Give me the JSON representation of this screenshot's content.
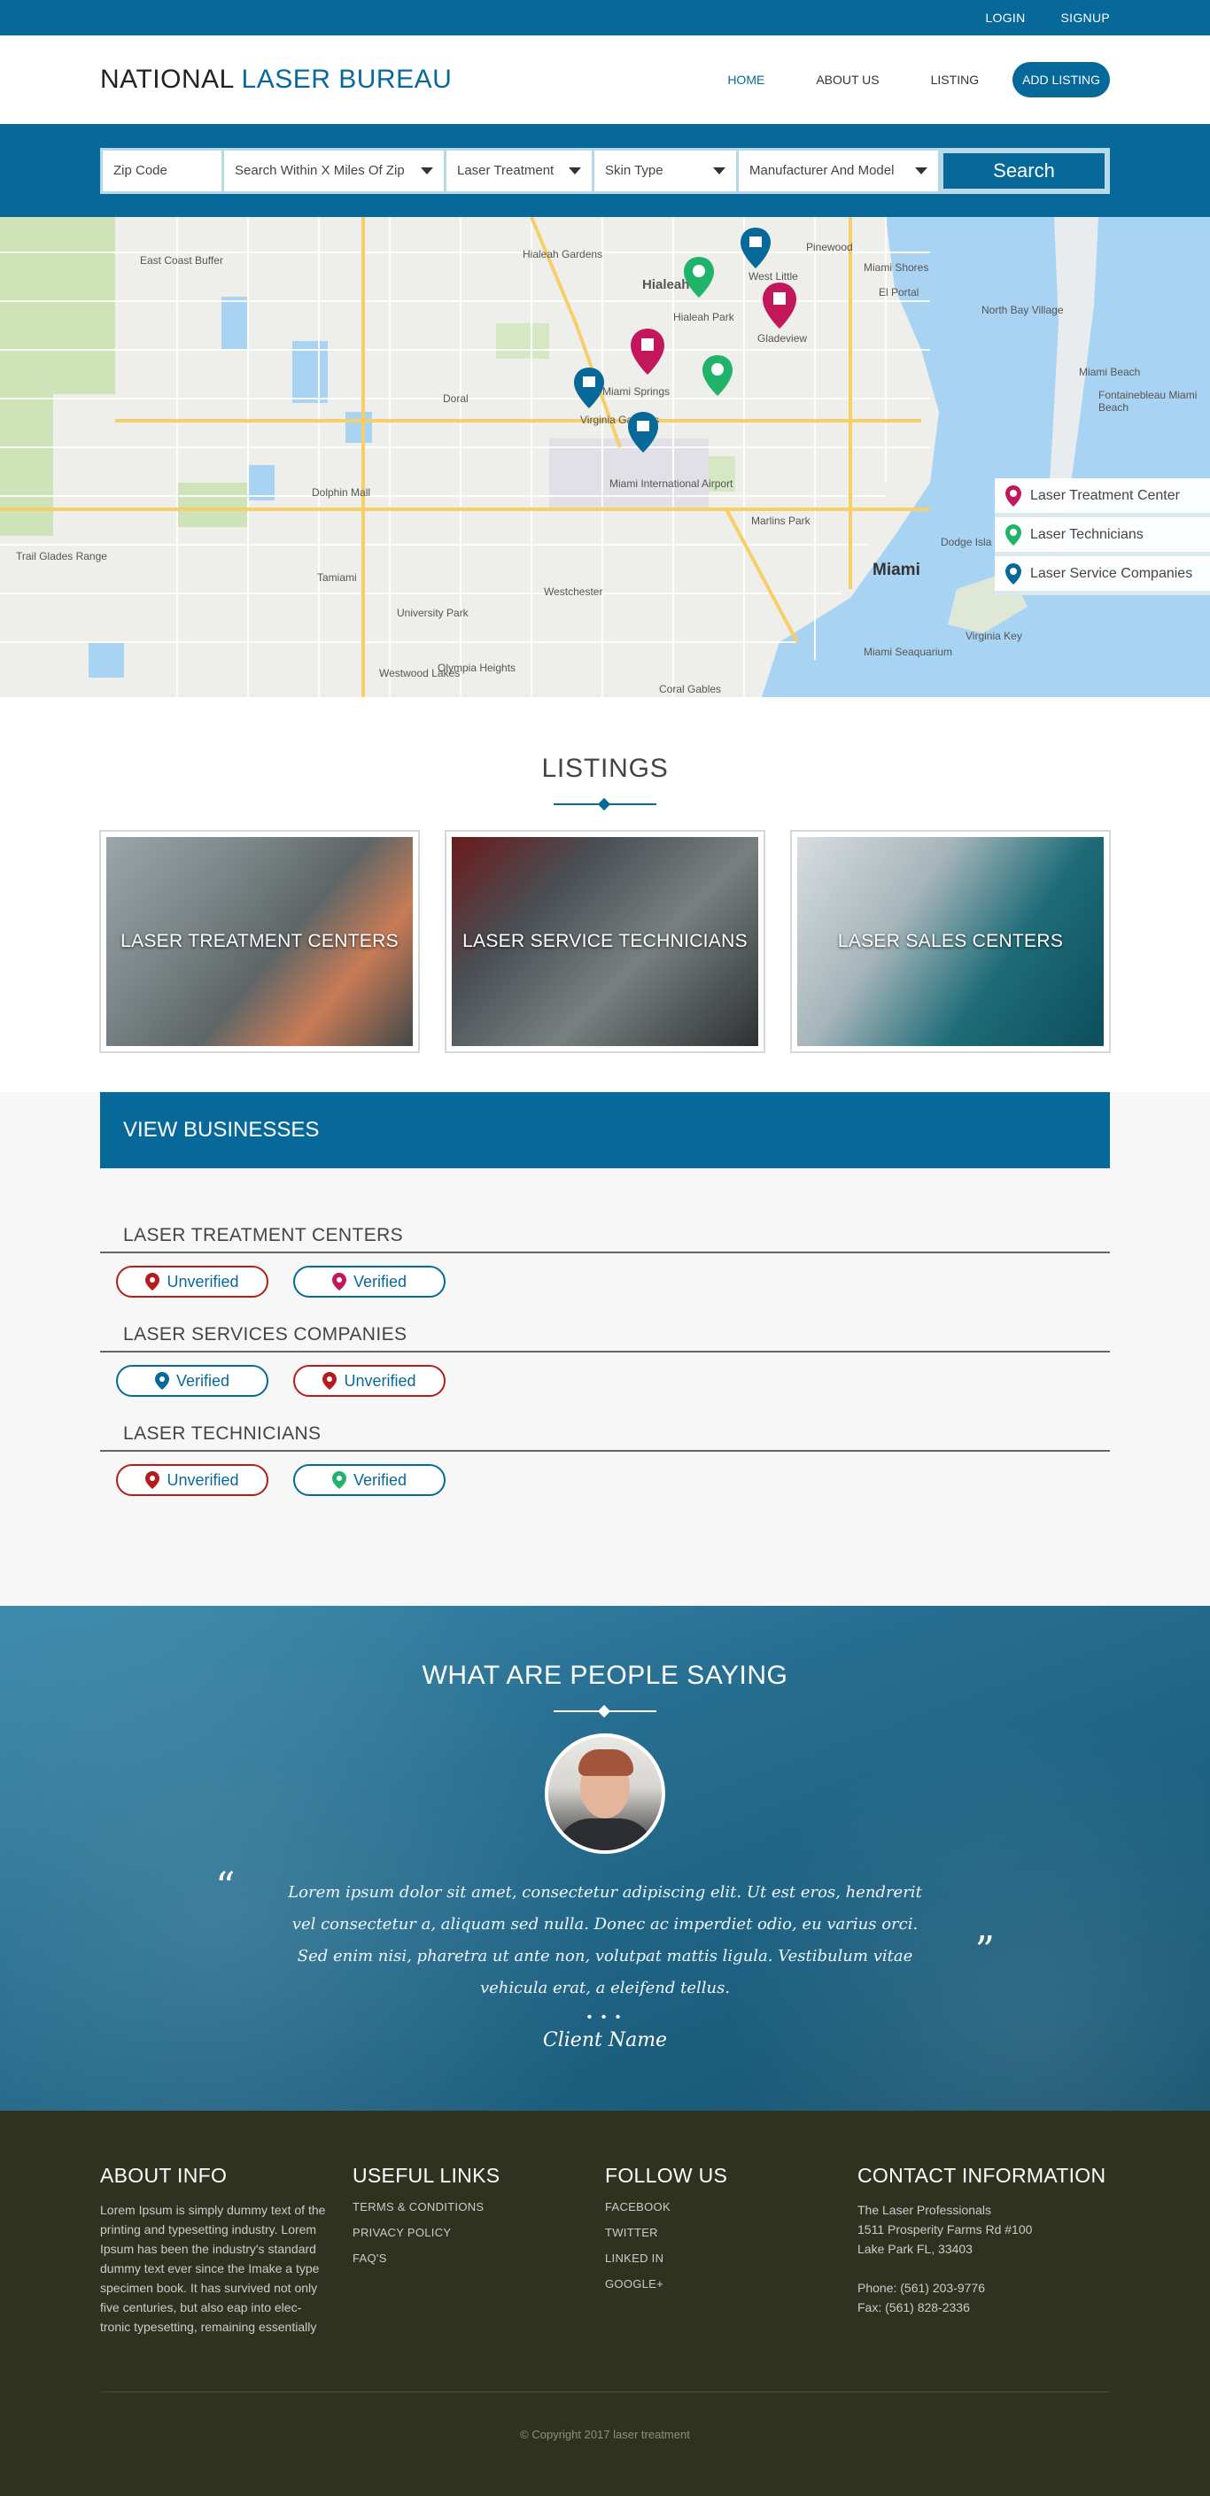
{
  "topbar": {
    "login": "LOGIN",
    "signup": "SIGNUP"
  },
  "brand": {
    "part1": "NATIONAL",
    "part2": "LASER BUREAU"
  },
  "nav": {
    "home": "HOME",
    "about": "ABOUT US",
    "listing": "LISTING",
    "add_listing": "ADD LISTING"
  },
  "search": {
    "zip": "Zip Code",
    "miles": "Search Within X Miles Of Zip",
    "treatment": "Laser Treatment",
    "skin": "Skin Type",
    "manufacturer": "Manufacturer And Model",
    "button": "Search"
  },
  "map": {
    "labels": {
      "east_coast_buffer": "East Coast Buffer",
      "hialeah_gardens": "Hialeah Gardens",
      "hialeah": "Hialeah",
      "hialeah_park": "Hialeah Park",
      "west_little": "West Little",
      "gladeview": "Gladeview",
      "miami_springs": "Miami Springs",
      "virginia_gardens": "Virginia Gardens",
      "doral": "Doral",
      "dolphin_mall": "Dolphin Mall",
      "miami_intl": "Miami International Airport",
      "marlins_park": "Marlins Park",
      "trail_glades": "Trail Glades Range",
      "tamiami": "Tamiami",
      "westchester": "Westchester",
      "university_park": "University Park",
      "westwood_lakes": "Westwood Lakes",
      "olympia_heights": "Olympia Heights",
      "coral_gables": "Coral Gables",
      "miami": "Miami",
      "miami_beach": "Miami Beach",
      "north_bay_village": "North Bay Village",
      "fontainebleau": "Fontainebleau Miami Beach",
      "miami_shores": "Miami Shores",
      "el_portal": "El Portal",
      "pinewood": "Pinewood",
      "virginia_key": "Virginia Key",
      "miami_seaquarium": "Miami Seaquarium",
      "dodge_isla": "Dodge Isla"
    },
    "legend": [
      "Laser Treatment Center",
      "Laser Technicians",
      "Laser Service Companies"
    ]
  },
  "colors": {
    "primary": "#07699a",
    "treatment": "#c2185b",
    "technician": "#22b36b",
    "service": "#07699a",
    "unverified": "#b71c1c",
    "footer_bg": "#2f321f"
  },
  "listings": {
    "title": "LISTINGS",
    "cards": [
      {
        "label": "LASER TREATMENT CENTERS"
      },
      {
        "label": "LASER SERVICE TECHNICIANS"
      },
      {
        "label": "LASER SALES CENTERS"
      }
    ]
  },
  "business": {
    "banner": "VIEW BUSINESSES",
    "groups": [
      {
        "title": "LASER TREATMENT CENTERS",
        "buttons": [
          "Unverified",
          "Verified"
        ]
      },
      {
        "title": "LASER SERVICES COMPANIES",
        "buttons": [
          "Verified",
          "Unverified"
        ]
      },
      {
        "title": "LASER TECHNICIANS",
        "buttons": [
          "Unverified",
          "Verified"
        ]
      }
    ]
  },
  "testimonials": {
    "title": "WHAT ARE PEOPLE SAYING",
    "quote": "Lorem ipsum dolor sit amet, consectetur adipiscing elit. Ut est eros, hendrerit vel consectetur a, aliquam sed nulla. Donec ac imperdiet odio, eu varius orci. Sed enim nisi, pharetra ut ante non, volutpat mattis ligula. Vestibulum vitae vehicula erat, a eleifend tellus.",
    "dots": "• • •",
    "client": "Client Name"
  },
  "footer": {
    "about": {
      "title": "ABOUT INFO",
      "text": "Lorem Ipsum is simply dummy text of the printing and typesetting industry. Lorem Ipsum has been the industry's standard dummy text ever since the  Imake a type specimen book. It has survived not only five centuries, but also eap into elec- tronic typesetting, remaining essentially"
    },
    "links": {
      "title": "USEFUL LINKS",
      "items": [
        "TERMS & CONDITIONS",
        "PRIVACY POLICY",
        "FAQ'S"
      ]
    },
    "follow": {
      "title": "FOLLOW US",
      "items": [
        "FACEBOOK",
        "TWITTER",
        "LINKED IN",
        "GOOGLE+"
      ]
    },
    "contact": {
      "title": "CONTACT INFORMATION",
      "name": "The Laser Professionals",
      "address1": "1511 Prosperity Farms Rd #100",
      "address2": "Lake Park FL, 33403",
      "phone": "Phone: (561) 203-9776",
      "fax": "Fax: (561) 828-2336"
    },
    "copyright": "© Copyright 2017 laser treatment"
  }
}
